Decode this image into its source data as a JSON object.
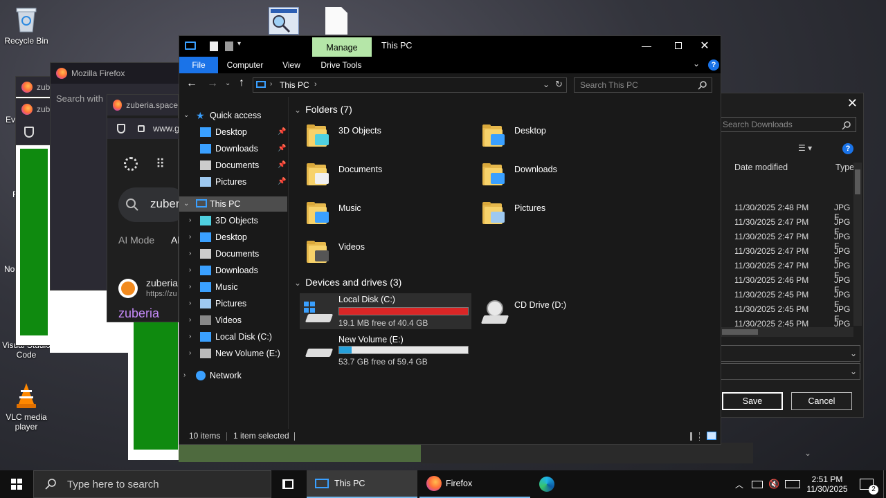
{
  "desktop": {
    "icons": [
      {
        "label": "Recycle Bin"
      },
      {
        "label": "Visual Studio Code"
      },
      {
        "label": "VLC media player"
      }
    ],
    "partial_labels": [
      "Ev",
      "F",
      "No"
    ]
  },
  "background_windows": {
    "firefox_title": "Mozilla Firefox",
    "firefox_search_placeholder": "Search with",
    "zuberia_tab": "zuberia.space",
    "zuberia_url": "www.g",
    "zuberia_search_text": "zuber",
    "ai_mode": "AI Mode",
    "all_tab": "Al",
    "result_title": "zuberia.",
    "result_url": "https://zu",
    "result_link": "zuberia ",
    "small_tabs": [
      "zub",
      "zub"
    ]
  },
  "explorer": {
    "title": "This PC",
    "manage_label": "Manage",
    "tabs": [
      "File",
      "Computer",
      "View",
      "Drive Tools"
    ],
    "address": {
      "crumb": "This PC",
      "search_placeholder": "Search This PC"
    },
    "nav": {
      "quick_access": "Quick access",
      "quick_items": [
        "Desktop",
        "Downloads",
        "Documents",
        "Pictures"
      ],
      "this_pc": "This PC",
      "pc_items": [
        "3D Objects",
        "Desktop",
        "Documents",
        "Downloads",
        "Music",
        "Pictures",
        "Videos",
        "Local Disk (C:)",
        "New Volume (E:)"
      ],
      "network": "Network"
    },
    "folders_header": "Folders (7)",
    "folders": [
      "3D Objects",
      "Desktop",
      "Documents",
      "Downloads",
      "Music",
      "Pictures",
      "Videos"
    ],
    "devices_header": "Devices and drives (3)",
    "drives": [
      {
        "name": "Local Disk (C:)",
        "free": "19.1 MB free of 40.4 GB",
        "used_fraction": 0.9995,
        "bar_color": "#da2626"
      },
      {
        "name": "New Volume (E:)",
        "free": "53.7 GB free of 59.4 GB",
        "used_fraction": 0.096,
        "bar_color": "#26a0da"
      },
      {
        "name": "CD Drive (D:)"
      }
    ],
    "status": {
      "items": "10 items",
      "selected": "1 item selected"
    }
  },
  "save_dialog": {
    "search_placeholder": "Search Downloads",
    "col_date": "Date modified",
    "col_type": "Type",
    "rows": [
      {
        "date": "11/30/2025 2:48 PM",
        "type": "JPG F"
      },
      {
        "date": "11/30/2025 2:47 PM",
        "type": "JPG F"
      },
      {
        "date": "11/30/2025 2:47 PM",
        "type": "JPG F"
      },
      {
        "date": "11/30/2025 2:47 PM",
        "type": "JPG F"
      },
      {
        "date": "11/30/2025 2:47 PM",
        "type": "JPG F"
      },
      {
        "date": "11/30/2025 2:46 PM",
        "type": "JPG F"
      },
      {
        "date": "11/30/2025 2:45 PM",
        "type": "JPG F"
      },
      {
        "date": "11/30/2025 2:45 PM",
        "type": "JPG F"
      },
      {
        "date": "11/30/2025 2:45 PM",
        "type": "JPG F"
      }
    ],
    "save_label": "Save",
    "cancel_label": "Cancel"
  },
  "taskbar": {
    "search_placeholder": "Type here to search",
    "apps": [
      "This PC",
      "Firefox"
    ],
    "time": "2:51 PM",
    "date": "11/30/2025",
    "notification_count": "2"
  }
}
